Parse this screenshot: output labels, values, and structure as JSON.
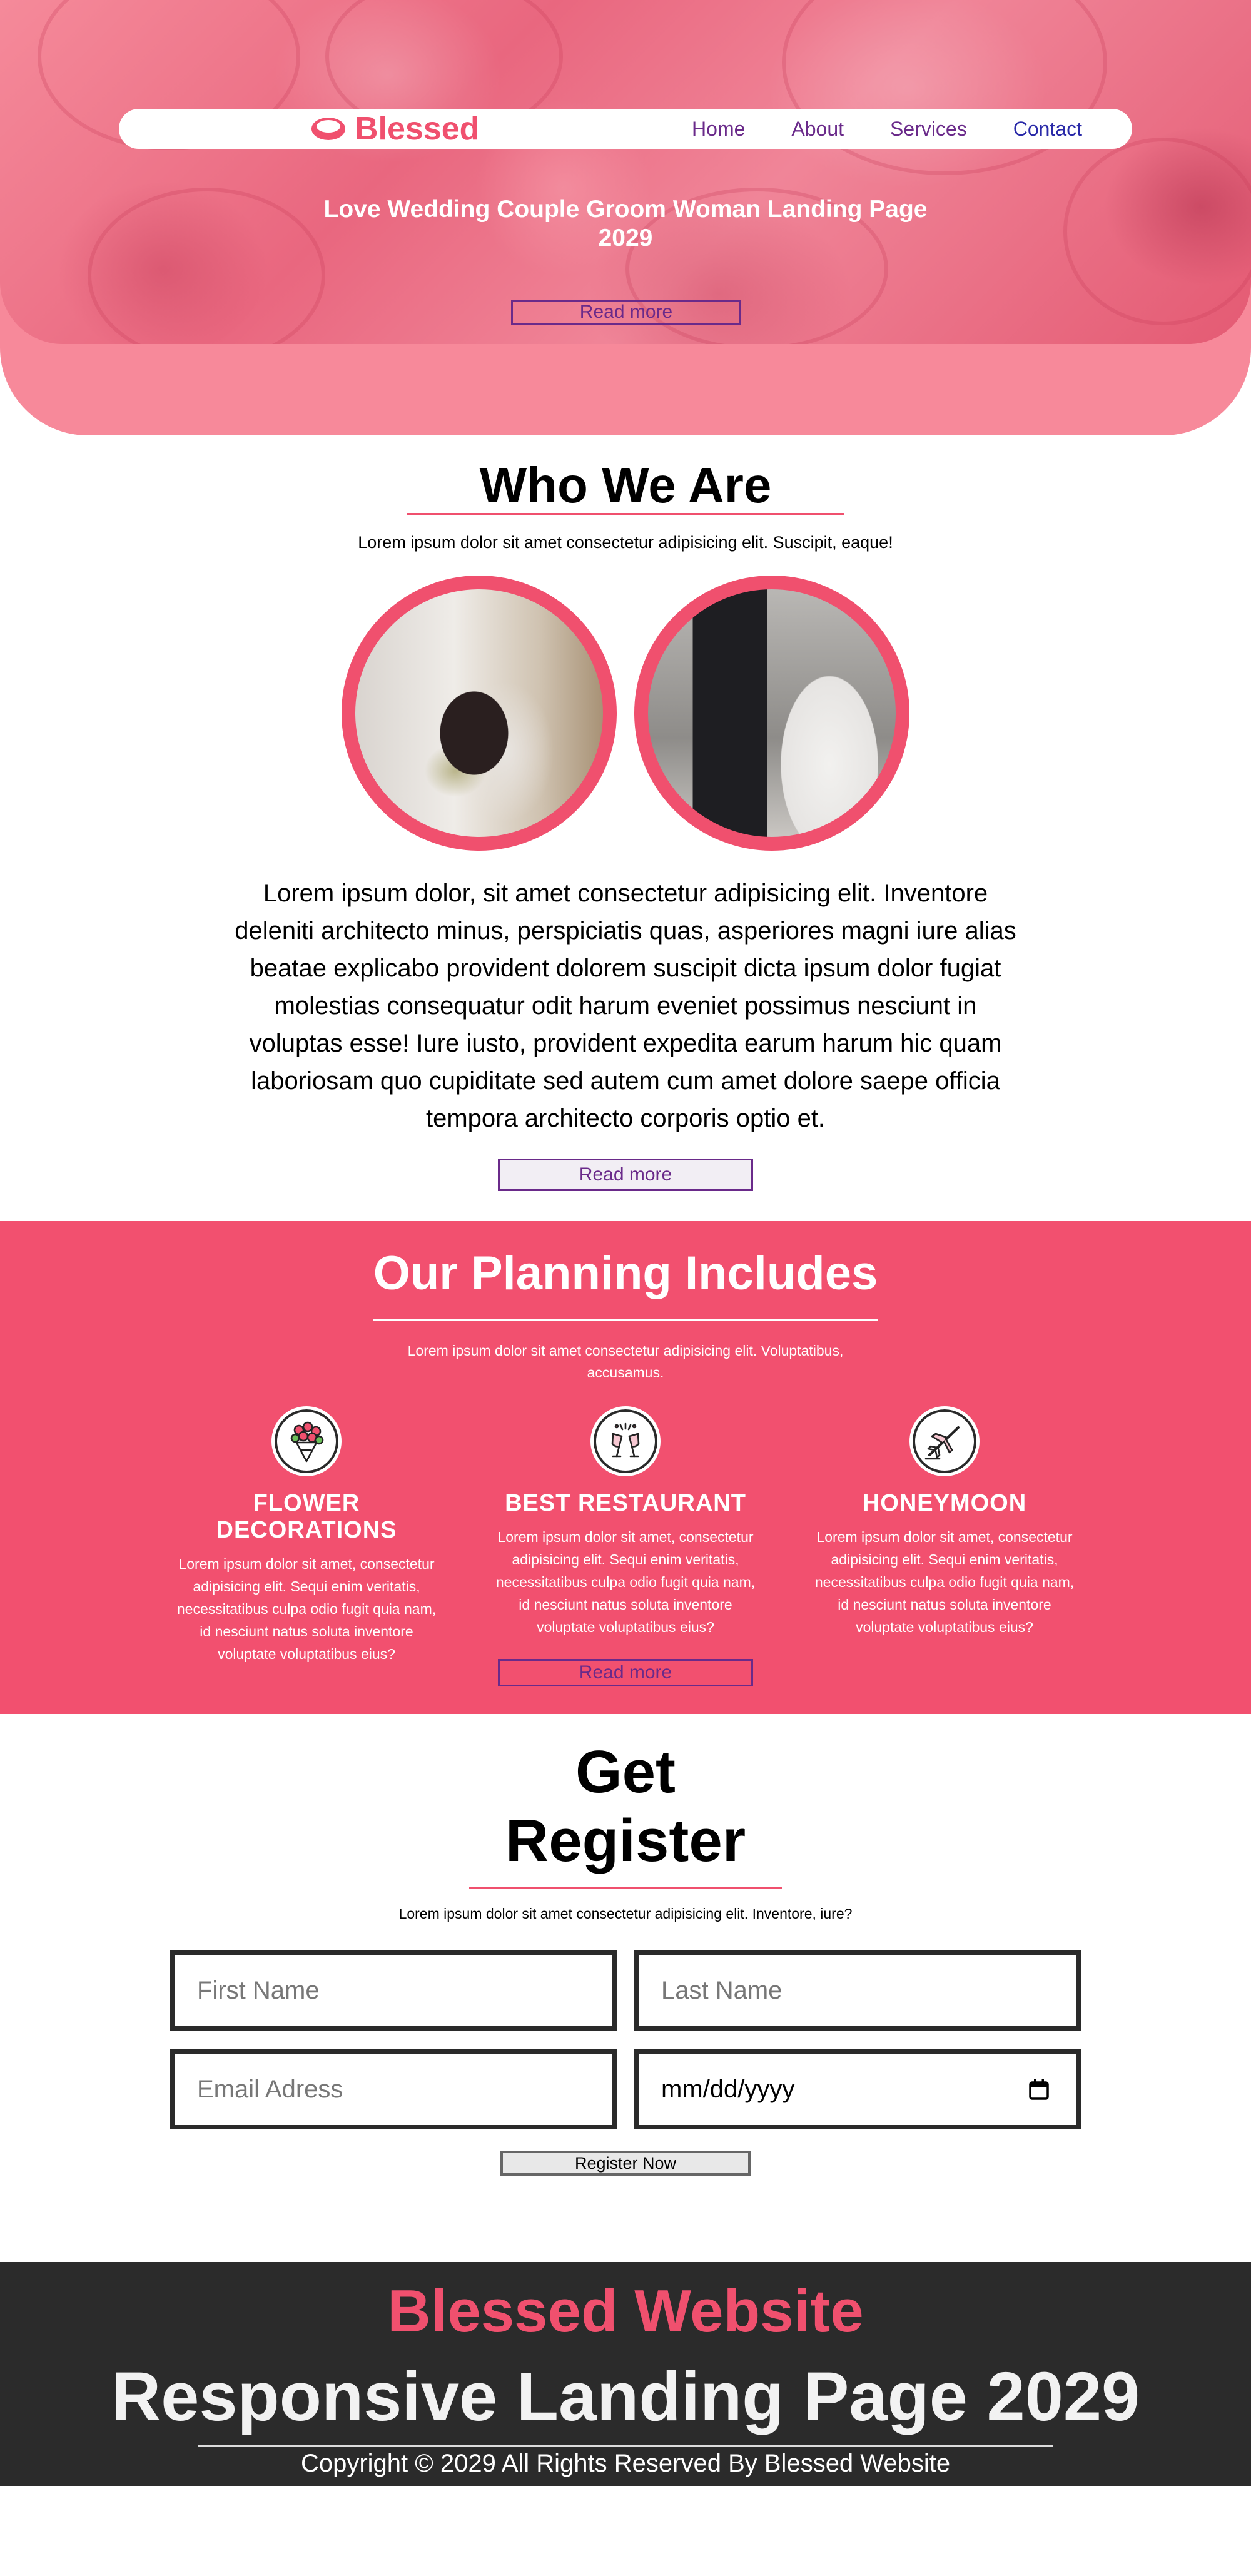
{
  "colors": {
    "accent": "#f0506e",
    "planning_bg": "#f2506f",
    "hero_overlay": "#f7899a",
    "footer_bg": "#2b2b2b",
    "nav_link": "#6a2a8a"
  },
  "header": {
    "logo": {
      "icon": "ring-icon",
      "text": "Blessed"
    },
    "nav": [
      {
        "label": "Home"
      },
      {
        "label": "About"
      },
      {
        "label": "Services"
      },
      {
        "label": "Contact"
      }
    ],
    "title": "Love Wedding Couple Groom Woman Landing Page 2029",
    "button_label": "Read more"
  },
  "who": {
    "title": "Who We Are",
    "subtitle": "Lorem ipsum dolor sit amet consectetur adipisicing elit. Suscipit, eaque!",
    "body": "Lorem ipsum dolor, sit amet consectetur adipisicing elit. Inventore deleniti architecto minus, perspiciatis quas, asperiores magni iure alias beatae explicabo provident dolorem suscipit dicta ipsum dolor fugiat molestias consequatur odit harum eveniet possimus nesciunt in voluptas esse! Iure iusto, provident expedita earum harum hic quam laboriosam quo cupiditate sed autem cum amet dolore saepe officia tempora architecto corporis optio et.",
    "button_label": "Read more"
  },
  "planning": {
    "title": "Our Planning Includes",
    "subtitle": "Lorem ipsum dolor sit amet consectetur adipisicing elit. Voluptatibus, accusamus.",
    "services": [
      {
        "icon": "bouquet-icon",
        "title": "FLOWER DECORATIONS",
        "text": "Lorem ipsum dolor sit amet, consectetur adipisicing elit. Sequi enim veritatis, necessitatibus culpa odio fugit quia nam, id nesciunt natus soluta inventore voluptate voluptatibus eius?"
      },
      {
        "icon": "champagne-toast-icon",
        "title": "BEST RESTAURANT",
        "text": "Lorem ipsum dolor sit amet, consectetur adipisicing elit. Sequi enim veritatis, necessitatibus culpa odio fugit quia nam, id nesciunt natus soluta inventore voluptate voluptatibus eius?"
      },
      {
        "icon": "airplane-icon",
        "title": "HONEYMOON",
        "text": "Lorem ipsum dolor sit amet, consectetur adipisicing elit. Sequi enim veritatis, necessitatibus culpa odio fugit quia nam, id nesciunt natus soluta inventore voluptate voluptatibus eius?"
      }
    ],
    "button_label": "Read more"
  },
  "register": {
    "title_line1": "Get",
    "title_line2": "Register",
    "subtitle": "Lorem ipsum dolor sit amet consectetur adipisicing elit. Inventore, iure?",
    "first_name_placeholder": "First Name",
    "last_name_placeholder": "Last Name",
    "email_placeholder": "Email Adress",
    "date_placeholder": "mm/dd/yyyy",
    "button_label": "Register Now"
  },
  "footer": {
    "brand": "Blessed Website",
    "tagline": "Responsive Landing Page 2029",
    "copyright": "Copyright © 2029 All Rights Reserved By Blessed Website"
  }
}
